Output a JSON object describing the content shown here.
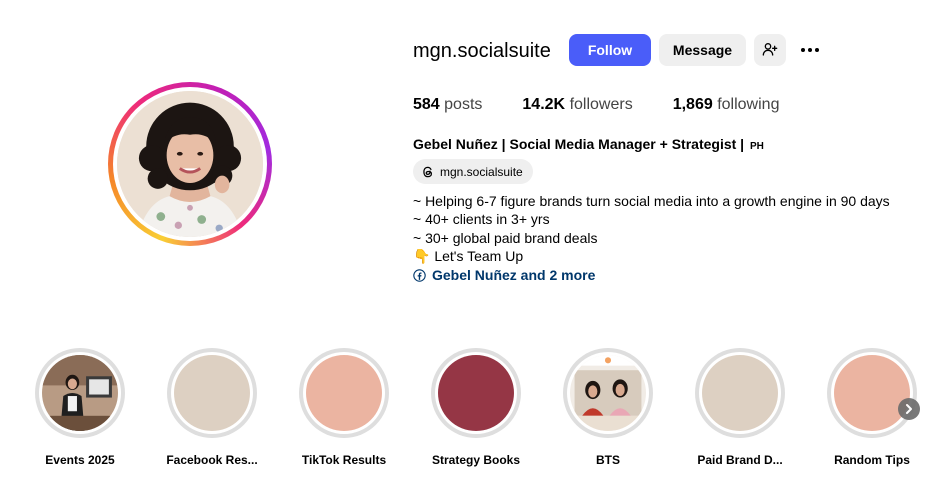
{
  "profile": {
    "username": "mgn.socialsuite",
    "follow_label": "Follow",
    "message_label": "Message",
    "add_user_icon": "person-add-icon",
    "more_icon": "more-options-icon"
  },
  "stats": {
    "posts_count": "584",
    "posts_label": "posts",
    "followers_count": "14.2K",
    "followers_label": "followers",
    "following_count": "1,869",
    "following_label": "following"
  },
  "bio": {
    "full_name": "Gebel Nuñez | Social Media Manager + Strategist |",
    "country_badge": "PH",
    "threads_handle": "mgn.socialsuite",
    "lines": [
      "~ Helping 6-7 figure brands turn social media into a growth engine in 90 days",
      "~ 40+ clients in 3+ yrs",
      "~ 30+ global paid brand deals",
      "👇 Let's Team Up"
    ],
    "links_text": "Gebel Nuñez and 2 more"
  },
  "highlights": [
    {
      "label": "Events 2025",
      "cover": "photo-events"
    },
    {
      "label": "Facebook Res...",
      "cover": "#ddd0c2"
    },
    {
      "label": "TikTok Results",
      "cover": "#ebb4a1"
    },
    {
      "label": "Strategy Books",
      "cover": "#953645"
    },
    {
      "label": "BTS",
      "cover": "photo-bts"
    },
    {
      "label": "Paid Brand D...",
      "cover": "#ddd0c2"
    },
    {
      "label": "Random Tips",
      "cover": "#ebb4a1"
    }
  ],
  "colors": {
    "follow_button": "#4a5df9",
    "secondary_button": "#efefef",
    "link_text": "#00376b"
  }
}
